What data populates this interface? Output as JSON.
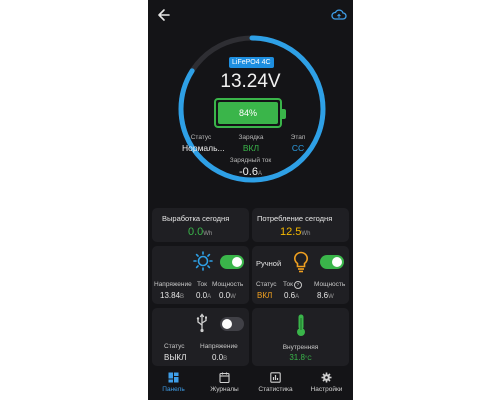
{
  "battery": {
    "chemistry": "LiFePO4 4C",
    "voltage": "13.24V",
    "soc_label": "84%",
    "soc_fraction": 0.84
  },
  "status": {
    "status_label": "Статус",
    "status_value": "Нормаль...",
    "charge_label": "Зарядка",
    "charge_value": "ВКЛ",
    "stage_label": "Этап",
    "stage_value": "CC",
    "current_label": "Зарядный ток",
    "current_value": "-0.6",
    "current_unit": "A"
  },
  "energy": {
    "gen_label": "Выработка сегодня",
    "gen_value": "0.0",
    "gen_unit": "Wh",
    "cons_label": "Потребление сегодня",
    "cons_value": "12.5",
    "cons_unit": "Wh"
  },
  "solar": {
    "icon": "sun-icon",
    "v_label": "Напряжение",
    "v_value": "13.84",
    "v_unit": "B",
    "i_label": "Ток",
    "i_value": "0.0",
    "i_unit": "A",
    "p_label": "Мощность",
    "p_value": "0.0",
    "p_unit": "W"
  },
  "load": {
    "mode": "Ручной",
    "icon": "lightbulb-icon",
    "status_label": "Статус",
    "status_value": "ВКЛ",
    "i_label": "Ток",
    "i_value": "0.6",
    "i_unit": "A",
    "p_label": "Мощность",
    "p_value": "8.6",
    "p_unit": "W"
  },
  "usb": {
    "icon": "usb-icon",
    "status_label": "Статус",
    "status_value": "ВЫКЛ",
    "v_label": "Напряжение",
    "v_value": "0.0",
    "v_unit": "B"
  },
  "temp": {
    "icon": "thermometer-icon",
    "label": "Внутренняя",
    "value": "31.8",
    "unit": "°C"
  },
  "nav": [
    {
      "label": "Панель",
      "icon": "dashboard-icon"
    },
    {
      "label": "Журналы",
      "icon": "journal-icon"
    },
    {
      "label": "Статистика",
      "icon": "chart-icon"
    },
    {
      "label": "Настройки",
      "icon": "gear-icon"
    }
  ],
  "colors": {
    "accent_blue": "#1e8fe0",
    "green": "#3ab54a",
    "yellow": "#f5b800",
    "orange": "#f0a020"
  }
}
